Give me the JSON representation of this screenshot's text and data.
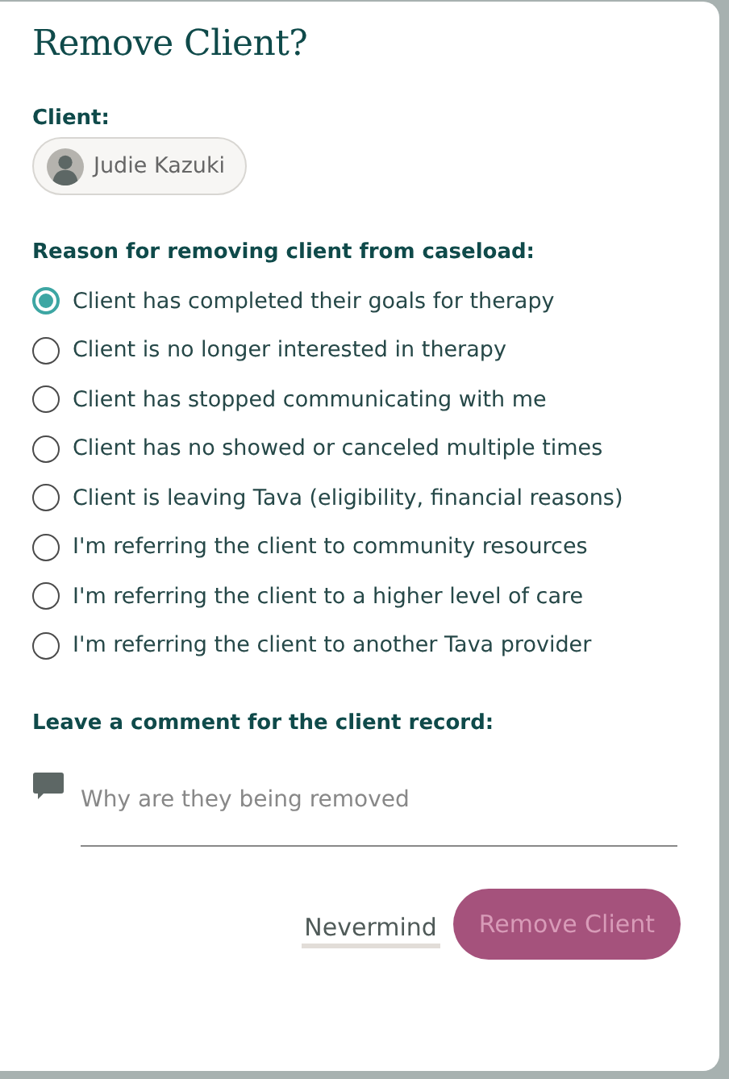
{
  "dialog": {
    "title": "Remove Client?"
  },
  "client": {
    "label": "Client:",
    "name": "Judie Kazuki"
  },
  "reason": {
    "label": "Reason for removing client from caseload:",
    "options": [
      {
        "label": "Client has completed their goals for therapy",
        "selected": true
      },
      {
        "label": "Client is no longer interested in therapy",
        "selected": false
      },
      {
        "label": "Client has stopped communicating with me",
        "selected": false
      },
      {
        "label": "Client has no showed or canceled multiple times",
        "selected": false
      },
      {
        "label": "Client is leaving Tava (eligibility, financial reasons)",
        "selected": false
      },
      {
        "label": "I'm referring the client to community resources",
        "selected": false
      },
      {
        "label": "I'm referring the client to a higher level of care",
        "selected": false
      },
      {
        "label": "I'm referring the client to another Tava provider",
        "selected": false
      }
    ]
  },
  "comment": {
    "label": "Leave a comment for the client record:",
    "placeholder": "Why are they being removed"
  },
  "actions": {
    "cancel": {
      "label": "Nevermind"
    },
    "confirm": {
      "label": "Remove Client",
      "disabled": true
    }
  }
}
